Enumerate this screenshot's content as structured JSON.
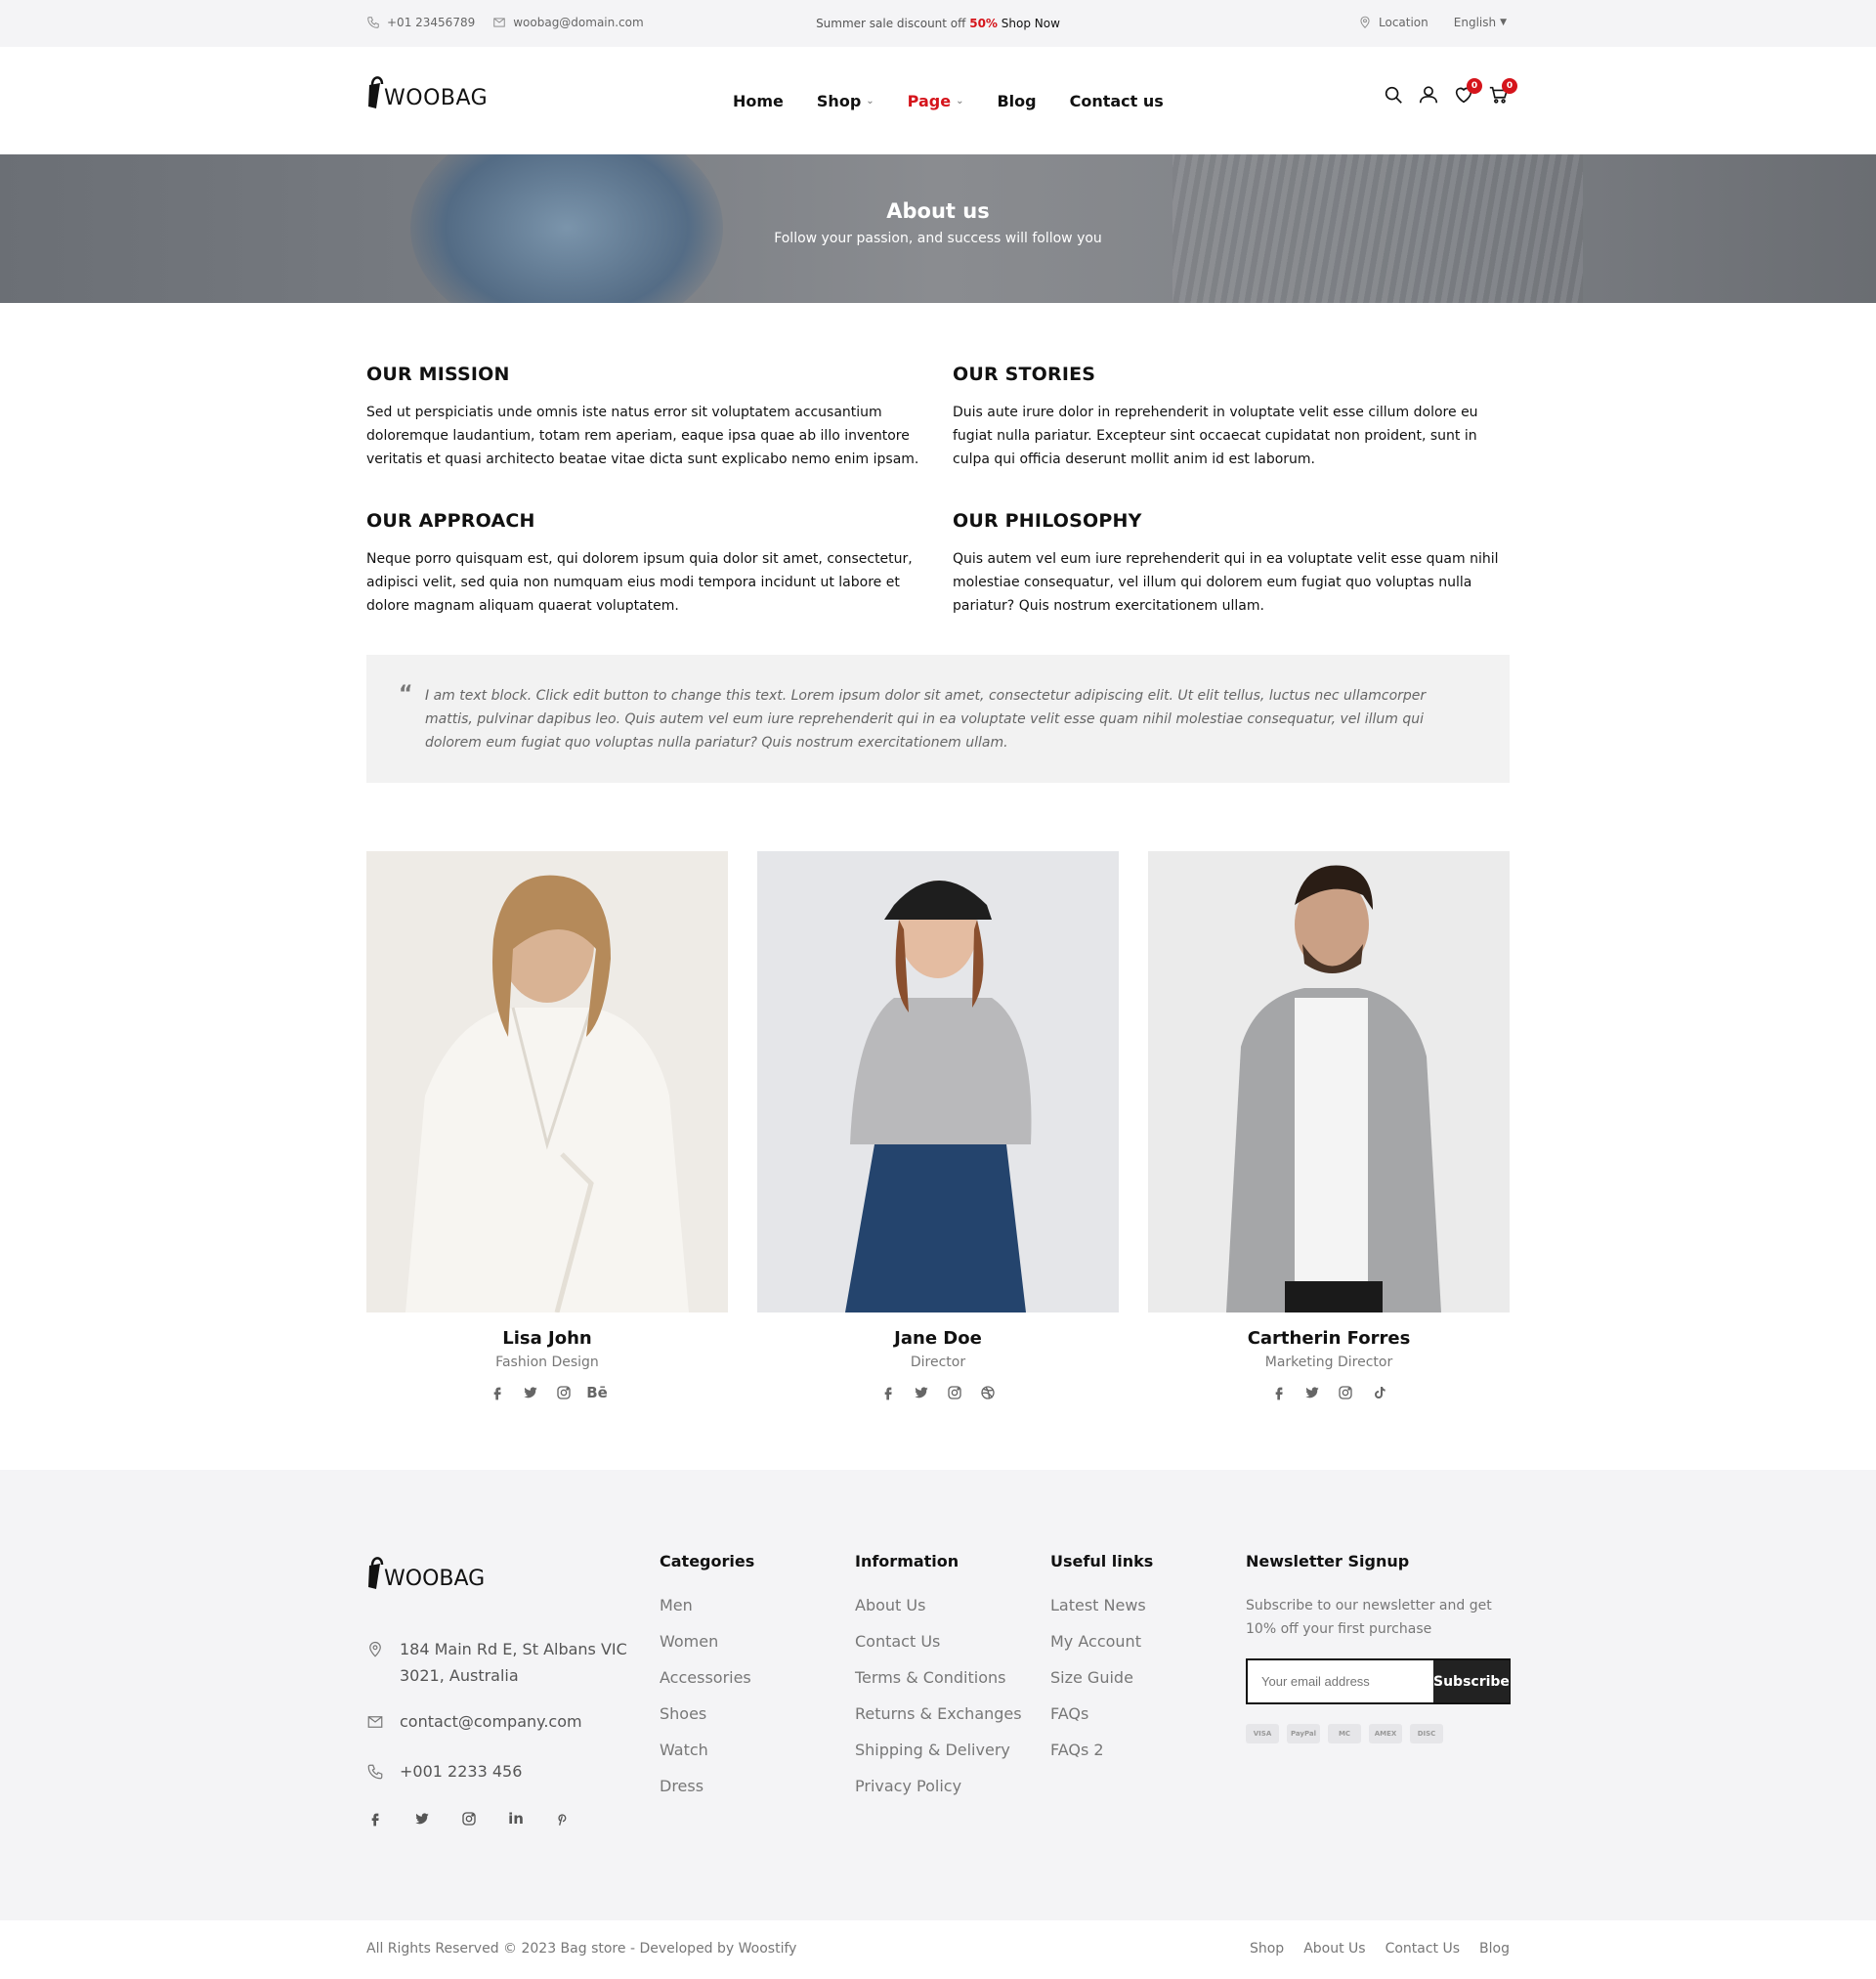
{
  "topbar": {
    "phone": "+01 23456789",
    "email": "woobag@domain.com",
    "promo_prefix": "Summer sale discount off ",
    "promo_percent": "50%",
    "promo_cta": " Shop Now",
    "location": "Location",
    "language": "English"
  },
  "header": {
    "logo": "WOOBAG",
    "nav": [
      {
        "label": "Home"
      },
      {
        "label": "Shop"
      },
      {
        "label": "Page"
      },
      {
        "label": "Blog"
      },
      {
        "label": "Contact us"
      }
    ],
    "wishlist_count": "0",
    "cart_count": "0"
  },
  "banner": {
    "title": "About us",
    "subtitle": "Follow your passion, and success will follow you"
  },
  "about": {
    "mission": {
      "title": "OUR MISSION",
      "text": "Sed ut perspiciatis unde omnis iste natus error sit voluptatem accusantium doloremque laudantium, totam rem aperiam, eaque ipsa quae ab illo inventore veritatis et quasi architecto beatae vitae dicta sunt explicabo nemo enim ipsam."
    },
    "stories": {
      "title": "OUR STORIES",
      "text": "Duis aute irure dolor in reprehenderit in voluptate velit esse cillum dolore eu fugiat nulla pariatur. Excepteur sint occaecat cupidatat non proident, sunt in culpa qui officia deserunt mollit anim id est laborum."
    },
    "approach": {
      "title": "OUR APPROACH",
      "text": "Neque porro quisquam est, qui dolorem ipsum quia dolor sit amet, consectetur, adipisci velit, sed quia non numquam eius modi tempora incidunt ut labore et dolore magnam aliquam quaerat voluptatem."
    },
    "philosophy": {
      "title": "OUR PHILOSOPHY",
      "text": "Quis autem vel eum iure reprehenderit qui in ea voluptate velit esse quam nihil molestiae consequatur, vel illum qui dolorem eum fugiat quo voluptas nulla pariatur? Quis nostrum exercitationem ullam."
    }
  },
  "quote": {
    "text": "I am text block. Click edit button to change this text. Lorem ipsum dolor sit amet, consectetur adipiscing elit. Ut elit tellus, luctus nec ullamcorper mattis, pulvinar dapibus leo. Quis autem vel eum iure reprehenderit qui in ea voluptate velit esse quam nihil molestiae consequatur, vel illum qui dolorem eum fugiat quo voluptas nulla pariatur? Quis nostrum exercitationem ullam."
  },
  "team": [
    {
      "name": "Lisa John",
      "role": "Fashion Design",
      "socials": [
        "facebook-icon",
        "twitter-icon",
        "instagram-icon",
        "behance-icon"
      ],
      "behance_label": "Bē"
    },
    {
      "name": "Jane Doe",
      "role": "Director",
      "socials": [
        "facebook-icon",
        "twitter-icon",
        "instagram-icon",
        "dribbble-icon"
      ]
    },
    {
      "name": "Cartherin Forres",
      "role": "Marketing Director",
      "socials": [
        "facebook-icon",
        "twitter-icon",
        "instagram-icon",
        "tiktok-icon"
      ]
    }
  ],
  "footer": {
    "logo": "WOOBAG",
    "address": "184 Main Rd E, St Albans VIC 3021, Australia",
    "email": "contact@company.com",
    "phone": "+001 2233 456",
    "social_in_label": "in",
    "categories": {
      "title": "Categories",
      "items": [
        "Men",
        "Women",
        "Accessories",
        "Shoes",
        "Watch",
        "Dress"
      ]
    },
    "information": {
      "title": "Information",
      "items": [
        "About Us",
        "Contact Us",
        "Terms & Conditions",
        "Returns & Exchanges",
        "Shipping & Delivery",
        "Privacy Policy"
      ]
    },
    "useful": {
      "title": "Useful links",
      "items": [
        "Latest News",
        "My Account",
        "Size Guide",
        "FAQs",
        "FAQs 2"
      ]
    },
    "newsletter": {
      "title": "Newsletter Signup",
      "text": "Subscribe to our newsletter and get 10% off your first purchase",
      "placeholder": "Your email address",
      "button": "Subscribe",
      "cards": [
        "VISA",
        "PayPal",
        "MC",
        "AMEX",
        "DISC"
      ]
    }
  },
  "bottom": {
    "copyright": "All Rights Reserved © 2023 Bag store - Developed by Woostify",
    "links": [
      "Shop",
      "About Us",
      "Contact Us",
      "Blog"
    ]
  }
}
